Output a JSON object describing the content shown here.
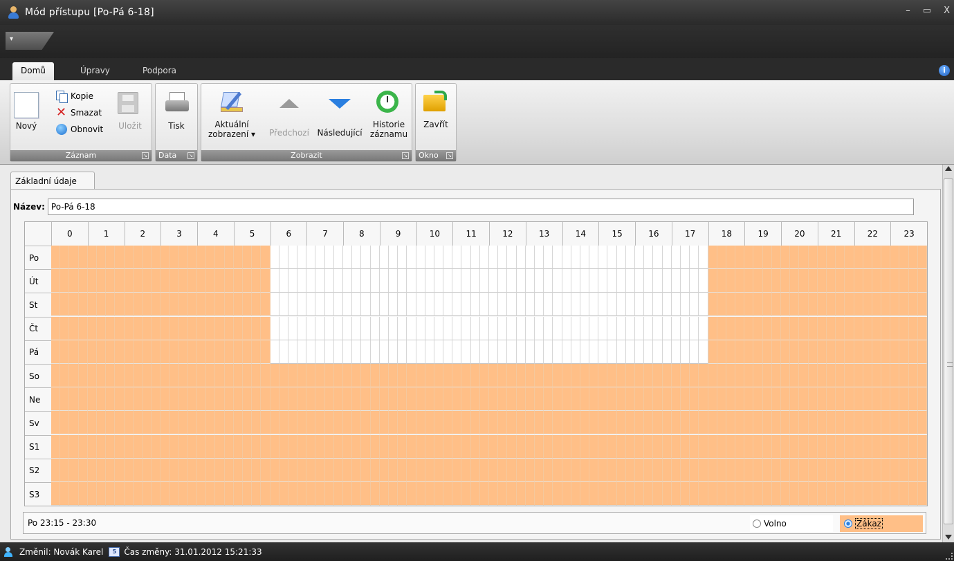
{
  "window": {
    "title": "Mód přístupu [Po-Pá 6-18]",
    "minimize": "–",
    "maximize": "▭",
    "close": "X"
  },
  "quick_access": {
    "label": "▾"
  },
  "ribbon_tabs": [
    "Domů",
    "Úpravy",
    "Podpora"
  ],
  "ribbon": {
    "groups": {
      "zaznam": "Záznam",
      "data": "Data",
      "zobrazit": "Zobrazit",
      "okno": "Okno"
    },
    "buttons": {
      "novy": "Nový",
      "kopie": "Kopie",
      "smazat": "Smazat",
      "obnovit": "Obnovit",
      "ulozit": "Uložit",
      "tisk": "Tisk",
      "aktualni_zobrazeni_1": "Aktuální",
      "aktualni_zobrazeni_2": "zobrazení ▾",
      "predchozi": "Předchozí",
      "nasledujici": "Následující",
      "historie_1": "Historie",
      "historie_2": "záznamu",
      "zavrit": "Zavřít"
    }
  },
  "tabs": [
    "Základní údaje"
  ],
  "form": {
    "name_label": "Název:",
    "name_value": "Po-Pá 6-18"
  },
  "schedule": {
    "hours": [
      "0",
      "1",
      "2",
      "3",
      "4",
      "5",
      "6",
      "7",
      "8",
      "9",
      "10",
      "11",
      "12",
      "13",
      "14",
      "15",
      "16",
      "17",
      "18",
      "19",
      "20",
      "21",
      "22",
      "23"
    ],
    "days": [
      "Po",
      "Út",
      "St",
      "Čt",
      "Pá",
      "So",
      "Ne",
      "Sv",
      "S1",
      "S2",
      "S3"
    ],
    "slots_per_hour": 4,
    "open_days": [
      "Po",
      "Út",
      "St",
      "Čt",
      "Pá"
    ],
    "open_from_hour": 6,
    "open_to_hour": 18,
    "colors": {
      "closed": "#ffbf87",
      "open": "#ffffff"
    }
  },
  "status": {
    "selection": "Po 23:15 - 23:30",
    "radio_volno": "Volno",
    "radio_zakaz": "Zákaz",
    "selected": "Zákaz"
  },
  "footer": {
    "changed_by": "Změnil: Novák Karel",
    "changed_time": "Čas změny: 31.01.2012 15:21:33",
    "cal_icon_text": "5"
  }
}
